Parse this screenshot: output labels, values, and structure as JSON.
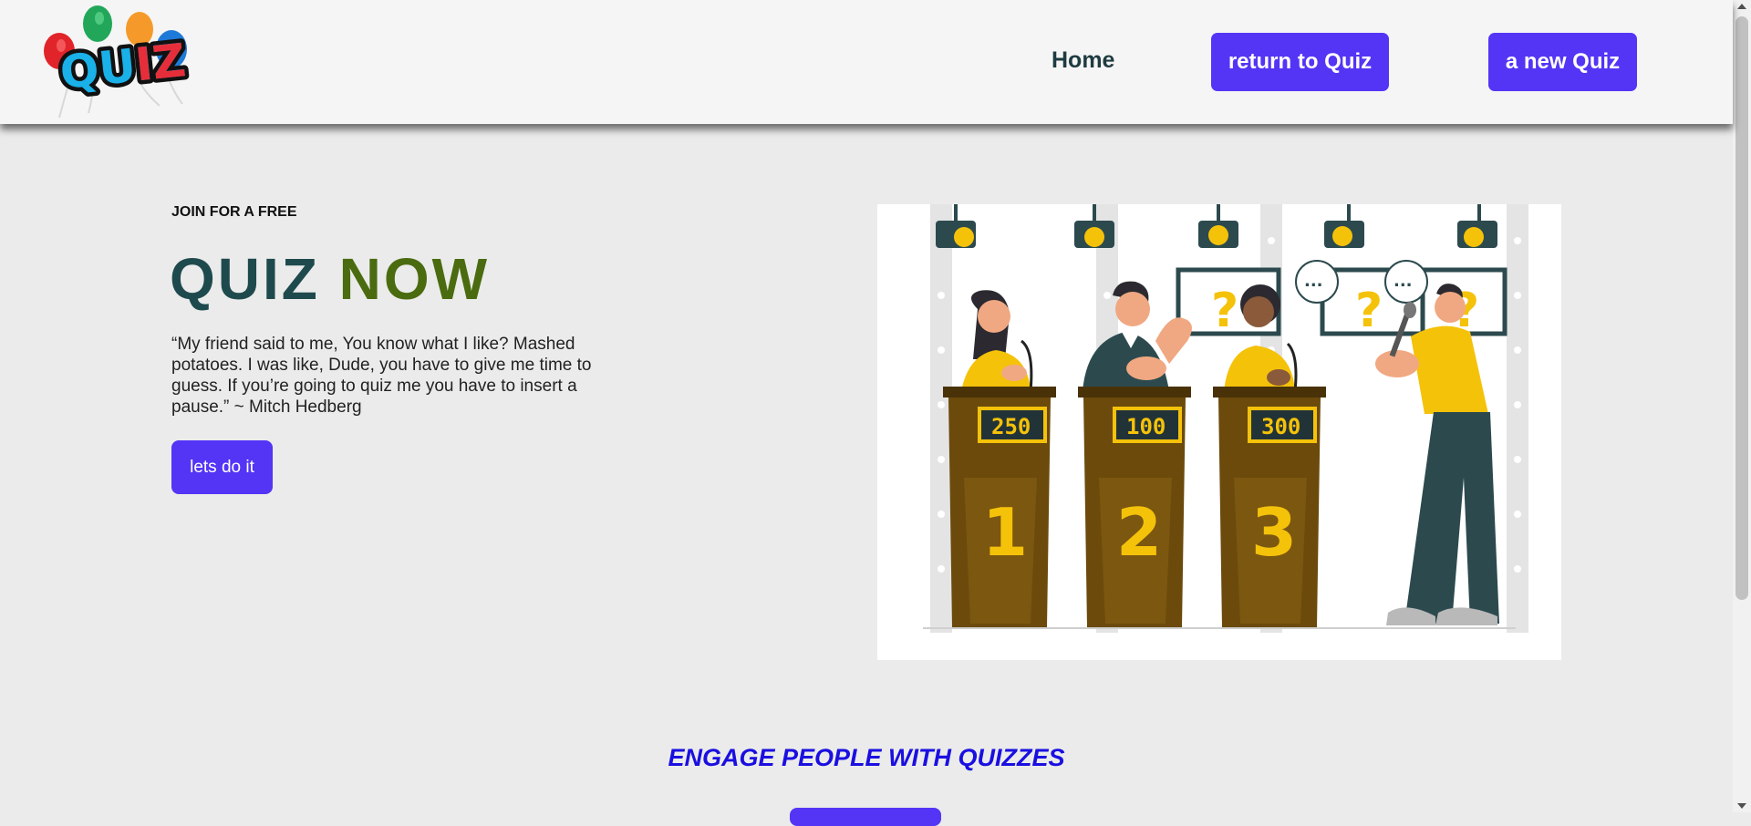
{
  "nav": {
    "logo_text": "QUIZ",
    "home_label": "Home",
    "return_label": "return to Quiz",
    "new_label": "a new Quiz"
  },
  "hero": {
    "eyebrow": "JOIN FOR A FREE",
    "title_part1": "QUIZ",
    "title_part2": "NOW",
    "quote": "“My friend said to me, You know what I like? Mashed potatoes. I was like, Dude, you have to give me time to guess. If you’re going to quiz me you have to insert a pause.” ~ Mitch Hedberg",
    "cta_label": "lets do it"
  },
  "illustration": {
    "scores": [
      "250",
      "100",
      "300"
    ],
    "podium_numbers": [
      "1",
      "2",
      "3"
    ],
    "question_mark": "?",
    "speech_dots": "..."
  },
  "section": {
    "title": "ENGAGE PEOPLE WITH QUIZZES"
  },
  "colors": {
    "accent": "#5435f5",
    "title_dark": "#1e4a4d",
    "title_green": "#4a6b0f",
    "section_blue": "#1a0fe0",
    "podium": "#6b4a0c",
    "yellow": "#f5c20a",
    "suit": "#2c4a4e"
  }
}
